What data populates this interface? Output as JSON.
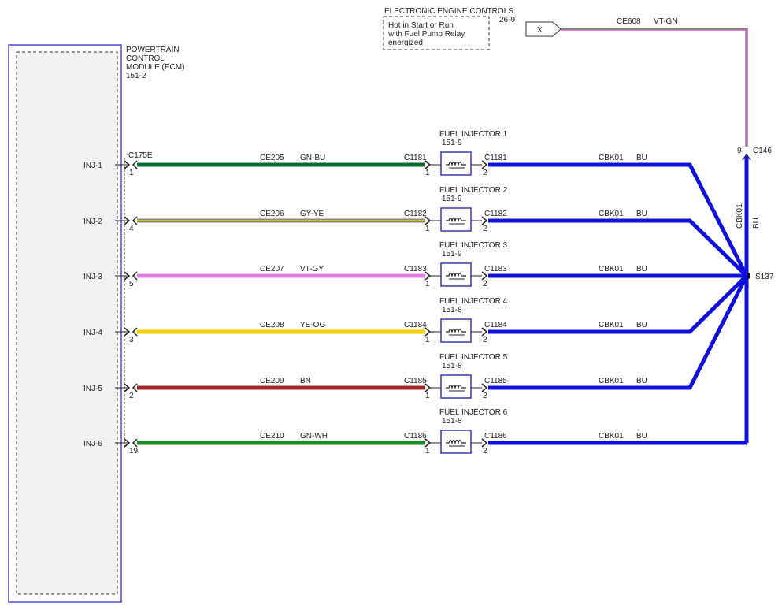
{
  "pcm": {
    "title_lines": [
      "POWERTRAIN",
      "CONTROL",
      "MODULE (PCM)",
      "151-2"
    ],
    "connector": "C175E"
  },
  "eec": {
    "title": "ELECTRONIC ENGINE CONTROLS",
    "page": "26-9",
    "note_lines": [
      "Hot in Start or Run",
      "with Fuel Pump Relay",
      "energized"
    ]
  },
  "feed": {
    "terminal_label": "X",
    "circuit": "CE608",
    "color_code": "VT-GN",
    "color": "#e07de0",
    "inline_connector": "C146",
    "inline_pin": "9"
  },
  "splice": {
    "id": "S137",
    "vertical_circuit": "CBK01",
    "vertical_color_code": "BU"
  },
  "ground_color": "#1010dd",
  "injectors": [
    {
      "pcm_pin_label": "INJ-1",
      "pcm_pin": "1",
      "circuit": "CE205",
      "color_code": "GN-BU",
      "wire_color": "#0e6a2e",
      "wire_color2": "#0e6a2e",
      "name": "FUEL INJECTOR 1",
      "ref": "151-9",
      "connector": "C1181",
      "pin_in": "1",
      "pin_out": "2",
      "ground_circuit": "CBK01",
      "ground_color_code": "BU"
    },
    {
      "pcm_pin_label": "INJ-2",
      "pcm_pin": "4",
      "circuit": "CE206",
      "color_code": "GY-YE",
      "wire_color": "#8a8a70",
      "wire_color2": "#e8d800",
      "name": "FUEL INJECTOR 2",
      "ref": "151-9",
      "connector": "C1182",
      "pin_in": "1",
      "pin_out": "2",
      "ground_circuit": "CBK01",
      "ground_color_code": "BU"
    },
    {
      "pcm_pin_label": "INJ-3",
      "pcm_pin": "5",
      "circuit": "CE207",
      "color_code": "VT-GY",
      "wire_color": "#e07de0",
      "wire_color2": "#e07de0",
      "name": "FUEL INJECTOR 3",
      "ref": "151-9",
      "connector": "C1183",
      "pin_in": "1",
      "pin_out": "2",
      "ground_circuit": "CBK01",
      "ground_color_code": "BU"
    },
    {
      "pcm_pin_label": "INJ-4",
      "pcm_pin": "3",
      "circuit": "CE208",
      "color_code": "YE-OG",
      "wire_color": "#f2d000",
      "wire_color2": "#f2d000",
      "name": "FUEL INJECTOR 4",
      "ref": "151-8",
      "connector": "C1184",
      "pin_in": "1",
      "pin_out": "2",
      "ground_circuit": "CBK01",
      "ground_color_code": "BU"
    },
    {
      "pcm_pin_label": "INJ-5",
      "pcm_pin": "2",
      "circuit": "CE209",
      "color_code": "BN",
      "wire_color": "#a02828",
      "wire_color2": "#a02828",
      "name": "FUEL INJECTOR 5",
      "ref": "151-8",
      "connector": "C1185",
      "pin_in": "1",
      "pin_out": "2",
      "ground_circuit": "CBK01",
      "ground_color_code": "BU"
    },
    {
      "pcm_pin_label": "INJ-6",
      "pcm_pin": "19",
      "circuit": "CE210",
      "color_code": "GN-WH",
      "wire_color": "#1a8a2a",
      "wire_color2": "#1a8a2a",
      "name": "FUEL INJECTOR 6",
      "ref": "151-8",
      "connector": "C1186",
      "pin_in": "1",
      "pin_out": "2",
      "ground_circuit": "CBK01",
      "ground_color_code": "BU"
    }
  ]
}
